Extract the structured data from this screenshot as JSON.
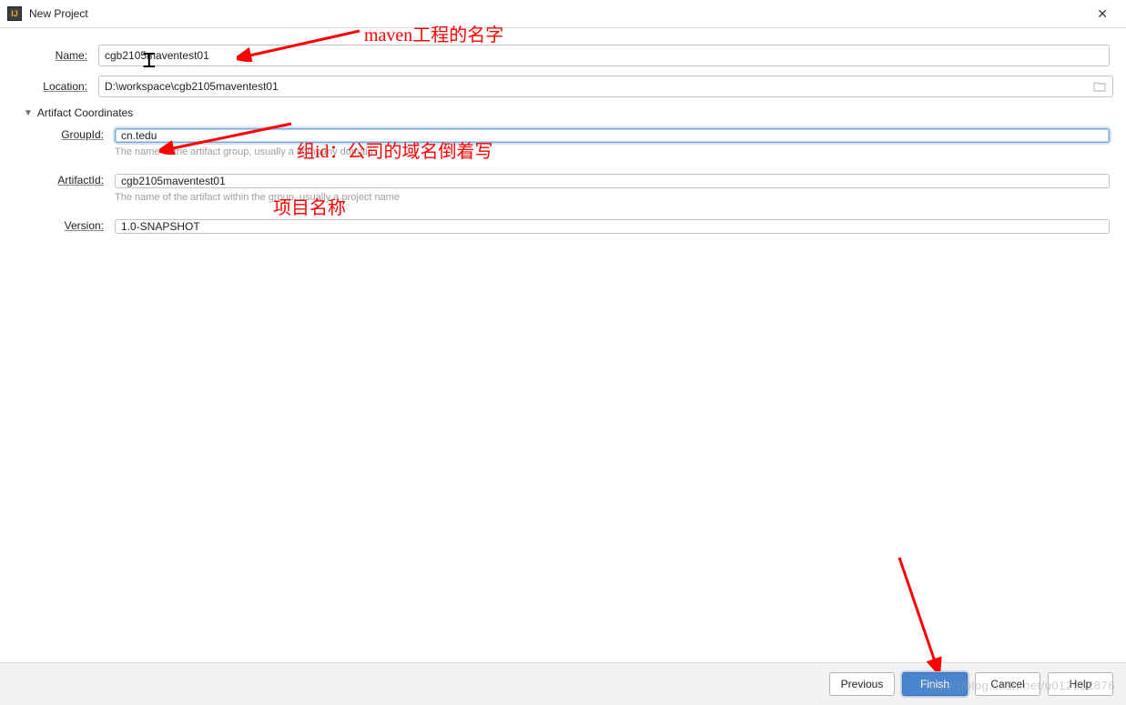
{
  "window": {
    "title": "New Project"
  },
  "form": {
    "name_label": "Name:",
    "name_value": "cgb2105maventest01",
    "location_label": "Location:",
    "location_value": "D:\\workspace\\cgb2105maventest01"
  },
  "artifact": {
    "section_label": "Artifact Coordinates",
    "groupid_label": "GroupId:",
    "groupid_value": "cn.tedu",
    "groupid_hint": "The name of the artifact group, usually a company domain",
    "artifactid_label": "ArtifactId:",
    "artifactid_value": "cgb2105maventest01",
    "artifactid_hint": "The name of the artifact within the group, usually a project name",
    "version_label": "Version:",
    "version_value": "1.0-SNAPSHOT"
  },
  "buttons": {
    "previous": "Previous",
    "finish": "Finish",
    "cancel": "Cancel",
    "help": "Help"
  },
  "annotations": {
    "a1": "maven工程的名字",
    "a2": "组id：公司的域名倒着写",
    "a3": "项目名称"
  },
  "watermark": "https://blog.csdn.net/u012932876"
}
